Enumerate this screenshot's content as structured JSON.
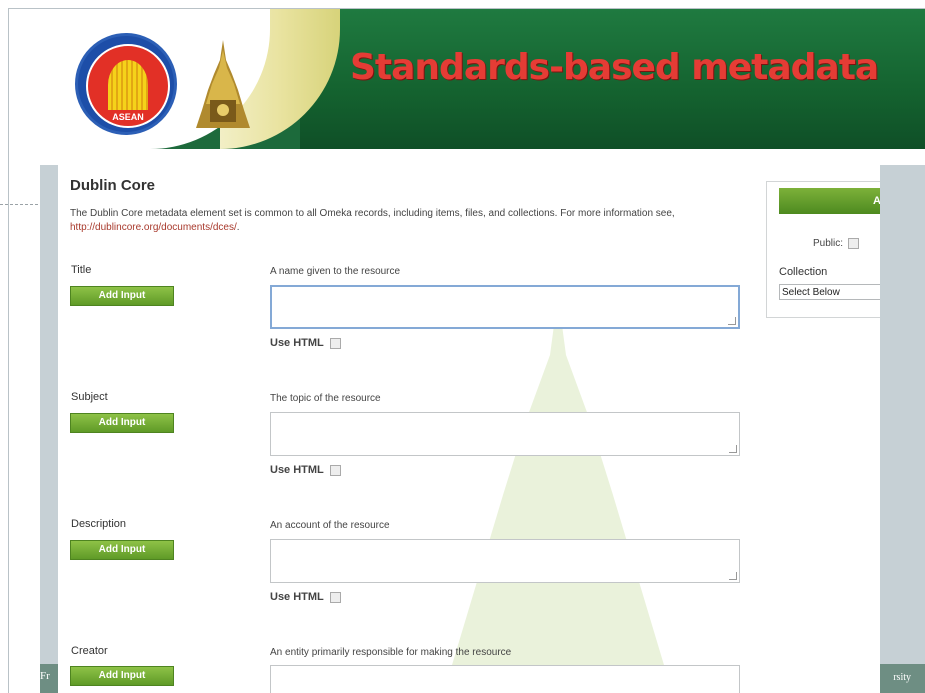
{
  "banner": {
    "title": "Standards-based metadata",
    "asean_logo_text": "ASEAN"
  },
  "section": {
    "heading": "Dublin Core",
    "description_prefix": "The Dublin Core metadata element set is common to all Omeka records, including items, files, and collections. For more information see, ",
    "description_link": "http://dublincore.org/documents/dces/",
    "description_suffix": "."
  },
  "fields": [
    {
      "label": "Title",
      "button": "Add Input",
      "description": "A name given to the resource",
      "use_html": "Use HTML"
    },
    {
      "label": "Subject",
      "button": "Add Input",
      "description": "The topic of the resource",
      "use_html": "Use HTML"
    },
    {
      "label": "Description",
      "button": "Add Input",
      "description": "An account of the resource",
      "use_html": "Use HTML"
    },
    {
      "label": "Creator",
      "button": "Add Input",
      "description": "An entity primarily responsible for making the resource"
    }
  ],
  "sidebar": {
    "button_label": "A",
    "public_label": "Public:",
    "collection_label": "Collection",
    "collection_select": "Select Below"
  },
  "footer": {
    "left_text": "Fr",
    "right_text": "rsity"
  },
  "colors": {
    "banner_green": "#1b6a3a",
    "title_red": "#e53c35",
    "button_green": "#6aa52d",
    "link": "#a8392c"
  }
}
